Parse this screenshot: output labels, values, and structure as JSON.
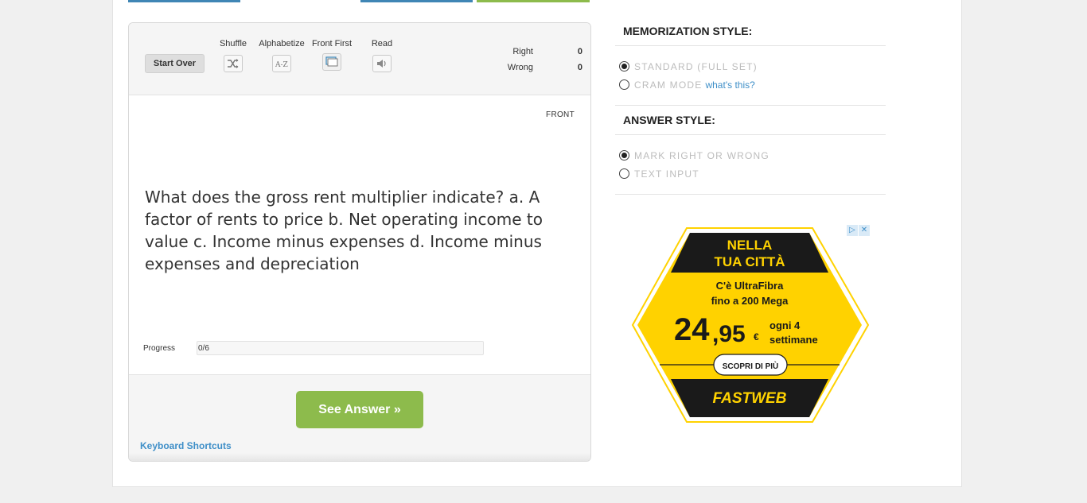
{
  "toolbar": {
    "start_over": "Start Over",
    "shuffle": "Shuffle",
    "alphabetize": "Alphabetize",
    "front_first": "Front First",
    "read": "Read"
  },
  "score": {
    "right_label": "Right",
    "right_value": "0",
    "wrong_label": "Wrong",
    "wrong_value": "0"
  },
  "card": {
    "side_label": "FRONT",
    "question": "What does the gross rent multiplier indicate? a. A factor of rents to price b. Net operating income to value c. Income minus expenses d. Income minus expenses and depreciation"
  },
  "progress": {
    "label": "Progress",
    "text": "0/6",
    "fraction": 0
  },
  "actions": {
    "see_answer": "See Answer »",
    "keyboard_shortcuts": "Keyboard Shortcuts"
  },
  "memorization": {
    "heading": "MEMORIZATION STYLE:",
    "options": [
      "STANDARD (FULL SET)",
      "CRAM MODE"
    ],
    "whats_this": "what's this?",
    "selected": 0
  },
  "answer_style": {
    "heading": "ANSWER STYLE:",
    "options": [
      "MARK RIGHT OR WRONG",
      "TEXT INPUT"
    ],
    "selected": 0
  },
  "ad": {
    "line1": "NELLA",
    "line2": "TUA CITTÀ",
    "line3": "C'è UltraFibra",
    "line4": "fino a 200 Mega",
    "price_int": "24",
    "price_dec": ",95",
    "currency": "€",
    "period1": "ogni 4",
    "period2": "settimane",
    "cta": "SCOPRI DI PIÙ",
    "brand": "FASTWEB",
    "adchoices": "▷",
    "close": "✕"
  },
  "colors": {
    "tab_blue": "#3f86b5",
    "tab_green": "#8dbb4c",
    "accent_green": "#8dbb4c",
    "link_blue": "#3f8fc8",
    "ad_yellow": "#ffd200",
    "ad_black": "#1a1a1a"
  },
  "icons": [
    "shuffle-icon",
    "alphabetize-icon",
    "front-first-icon",
    "speaker-icon"
  ]
}
